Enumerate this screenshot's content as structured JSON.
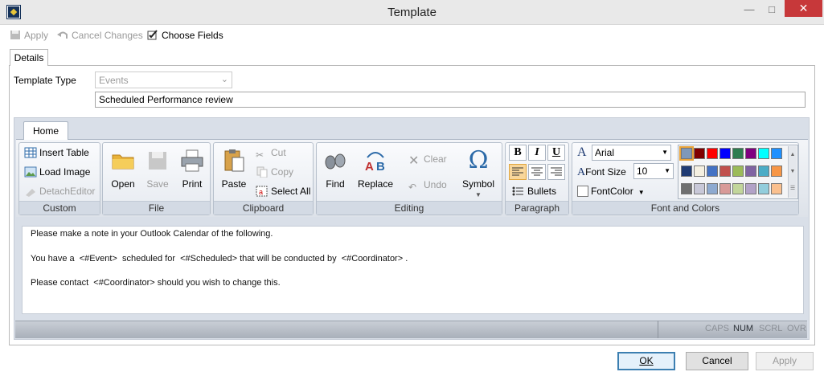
{
  "window": {
    "title": "Template"
  },
  "toolbar": {
    "apply": "Apply",
    "cancel_changes": "Cancel Changes",
    "choose_fields": "Choose Fields"
  },
  "tabs": {
    "details": "Details"
  },
  "form": {
    "template_type_label": "Template Type",
    "template_type_value": "Events",
    "name_value": "Scheduled Performance review"
  },
  "ribbon": {
    "home_tab": "Home",
    "custom": {
      "label": "Custom",
      "insert_table": "Insert Table",
      "load_image": "Load Image",
      "detach_editor": "DetachEditor"
    },
    "file": {
      "label": "File",
      "open": "Open",
      "save": "Save",
      "print": "Print"
    },
    "clipboard": {
      "label": "Clipboard",
      "paste": "Paste",
      "cut": "Cut",
      "copy": "Copy",
      "select_all": "Select All"
    },
    "editing": {
      "label": "Editing",
      "find": "Find",
      "replace": "Replace",
      "clear": "Clear",
      "undo": "Undo",
      "symbol": "Symbol"
    },
    "paragraph": {
      "label": "Paragraph",
      "bold": "B",
      "italic": "I",
      "underline": "U",
      "bullets": "Bullets"
    },
    "font": {
      "label": "Font and Colors",
      "font_name": "Arial",
      "font_size_label": "Font Size",
      "font_size": "10",
      "font_color_label": "FontColor"
    }
  },
  "colors": {
    "row1": [
      "#7f98b8",
      "#800000",
      "#ff0000",
      "#0000ff",
      "#2e7d4f",
      "#800080",
      "#00ffff",
      "#1e90ff"
    ],
    "row2": [
      "#1f3b73",
      "#f5f0e1",
      "#4472c4",
      "#c0504d",
      "#9bbb59",
      "#8064a2",
      "#4bacc6",
      "#f79646"
    ],
    "row3": [
      "#707070",
      "#c8c8d8",
      "#8eaad0",
      "#d89a98",
      "#c2d69b",
      "#b2a2c7",
      "#92cddc",
      "#fac08f"
    ]
  },
  "editor": {
    "lines": [
      "Please make a note in your Outlook Calendar of the following.",
      "You have a  <#Event>  scheduled for  <#Scheduled> that will be conducted by  <#Coordinator> .",
      "Please contact  <#Coordinator> should you wish to change this."
    ]
  },
  "status": {
    "caps": "CAPS",
    "num": "NUM",
    "scrl": "SCRL",
    "ovr": "OVR"
  },
  "buttons": {
    "ok": "OK",
    "cancel": "Cancel",
    "apply": "Apply"
  }
}
